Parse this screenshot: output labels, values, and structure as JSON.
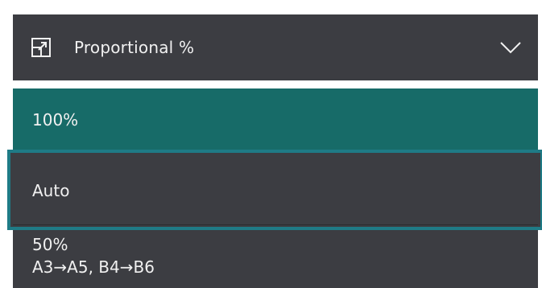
{
  "dropdown": {
    "label": "Proportional %",
    "icon": "resize-diagonal-icon",
    "expanded": true
  },
  "options": [
    {
      "label": "100%",
      "selected": true
    },
    {
      "label": "Auto",
      "focused": true
    },
    {
      "label": "50%",
      "sublabel": "A3→A5, B4→B6"
    }
  ],
  "colors": {
    "header_bg": "#3c3d42",
    "selected_bg": "#176b68",
    "focus_outline": "#1f7b86",
    "text": "#f1f1f1"
  }
}
